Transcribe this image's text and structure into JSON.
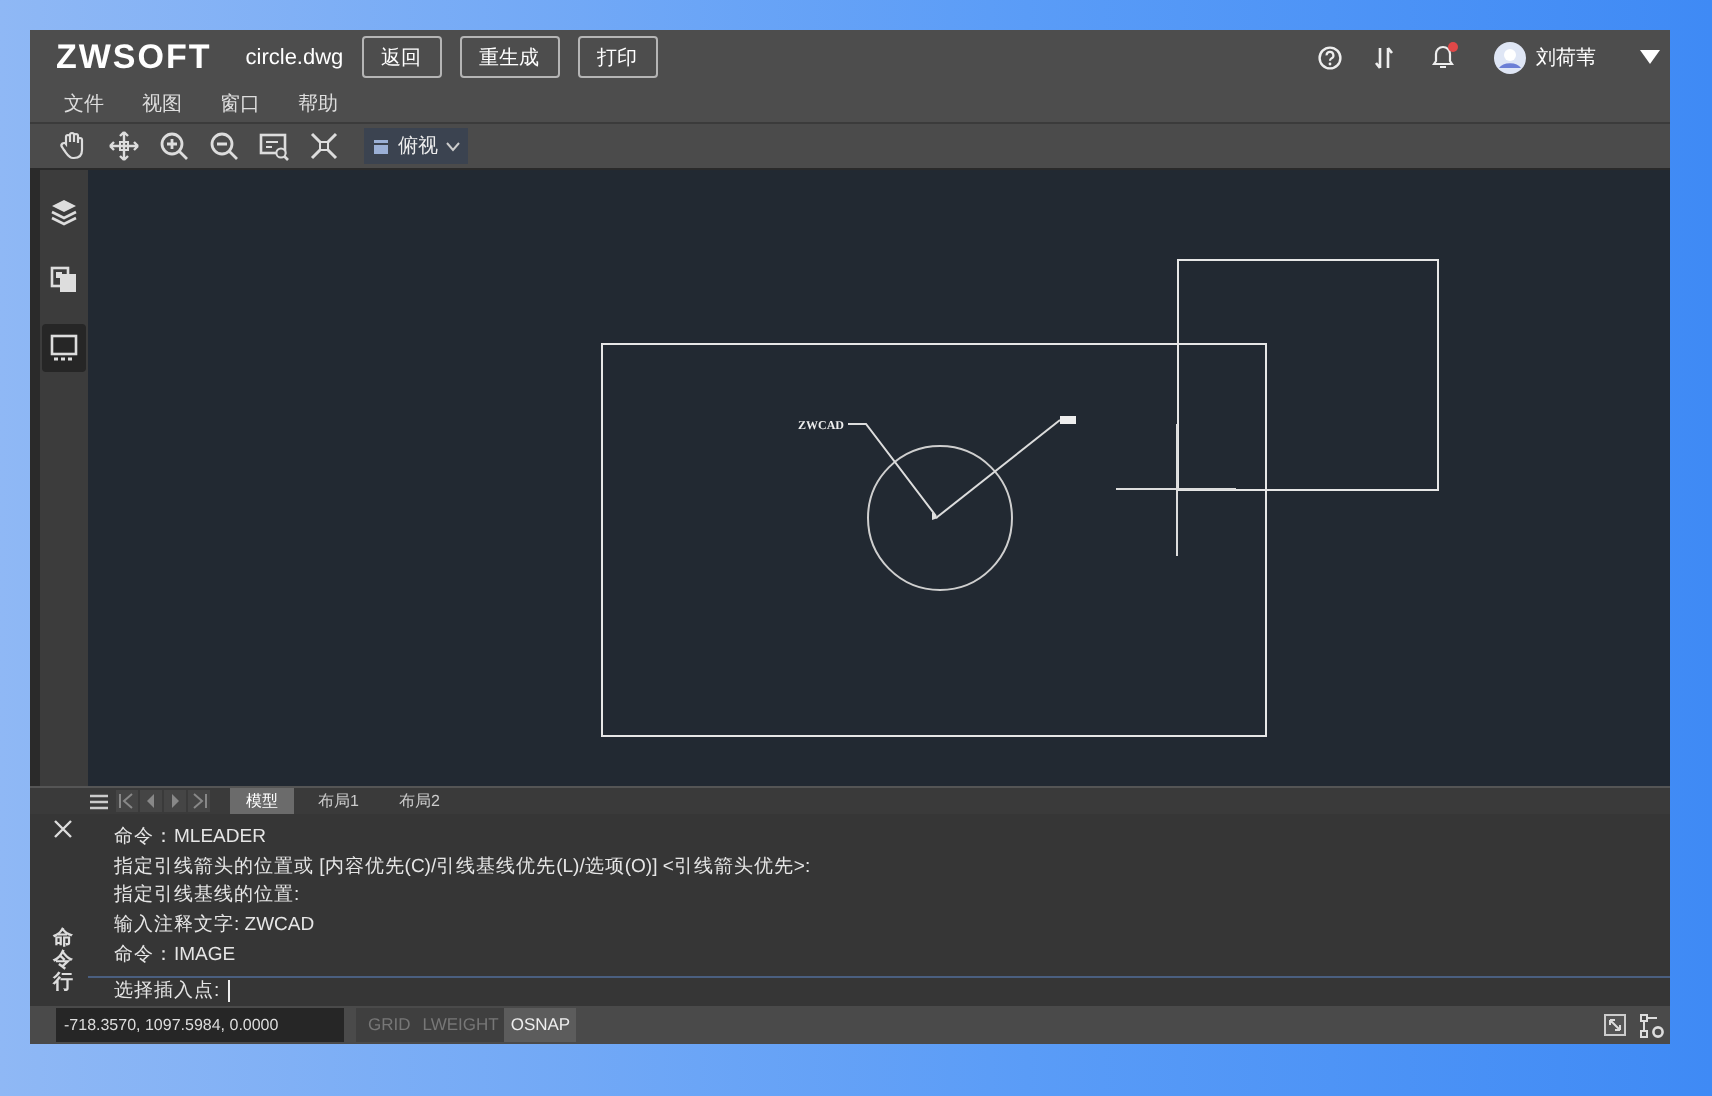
{
  "app": {
    "logo": "ZWSOFT",
    "file_name": "circle.dwg",
    "buttons": [
      "返回",
      "重生成",
      "打印"
    ],
    "notification": {
      "unread": true
    },
    "user": {
      "name": "刘荷苇"
    }
  },
  "menu": [
    "文件",
    "视图",
    "窗口",
    "帮助"
  ],
  "toolbar": {
    "tools": [
      {
        "kind": "pan"
      },
      {
        "kind": "move"
      },
      {
        "kind": "zoom_in"
      },
      {
        "kind": "zoom_out"
      },
      {
        "kind": "zoom_window"
      },
      {
        "kind": "extents"
      }
    ],
    "view_select": "俯视"
  },
  "sidebar": [
    {
      "kind": "layers",
      "selected": false
    },
    {
      "kind": "copy",
      "selected": false
    },
    {
      "kind": "display",
      "selected": true
    }
  ],
  "drawing": {
    "annotation": "ZWCAD"
  },
  "layout_tabs": [
    {
      "label": "模型",
      "selected": true
    },
    {
      "label": "布局1",
      "selected": false
    },
    {
      "label": "布局2",
      "selected": false
    }
  ],
  "command_panel": {
    "title": "命令行",
    "history": [
      "命令：MLEADER",
      "指定引线箭头的位置或 [内容优先(C)/引线基线优先(L)/选项(O)] <引线箭头优先>:",
      "指定引线基线的位置:",
      "输入注释文字: ZWCAD",
      "命令：IMAGE"
    ],
    "prompt": "选择插入点:"
  },
  "status_bar": {
    "coordinates": "-718.3570, 1097.5984, 0.0000",
    "toggles": [
      {
        "label": "GRID",
        "on": false
      },
      {
        "label": "LWEIGHT",
        "on": false
      },
      {
        "label": "OSNAP",
        "on": true
      }
    ]
  }
}
